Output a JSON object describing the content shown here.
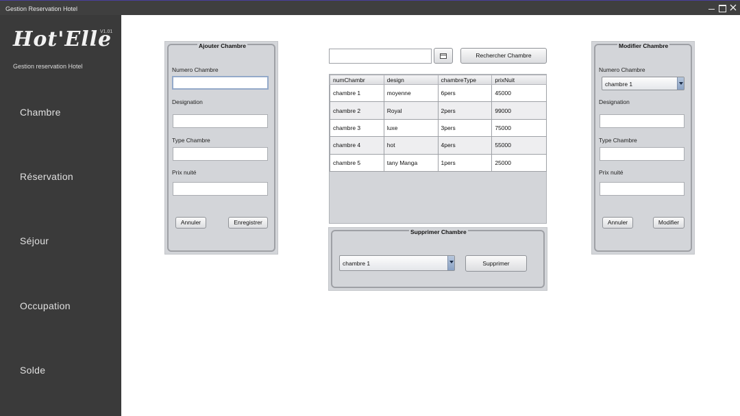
{
  "window": {
    "title": "Gestion Reservation Hotel"
  },
  "sidebar": {
    "logo": "Hot'Elle",
    "version": "V1.01",
    "subtitle": "Gestion reservation Hotel",
    "items": [
      {
        "label": "Chambre"
      },
      {
        "label": "Réservation"
      },
      {
        "label": "Séjour"
      },
      {
        "label": "Occupation"
      },
      {
        "label": "Solde"
      }
    ]
  },
  "add_panel": {
    "title": "Ajouter Chambre",
    "numero_label": "Numero Chambre",
    "numero_value": "",
    "designation_label": "Designation",
    "designation_value": "",
    "type_label": "Type Chambre",
    "type_value": "",
    "prix_label": "Prix nuité",
    "prix_value": "",
    "cancel_label": "Annuler",
    "save_label": "Enregistrer"
  },
  "search": {
    "value": "",
    "button_label": "Rechercher Chambre"
  },
  "table": {
    "columns": [
      "numChambr",
      "design",
      "chambreType",
      "prixNuit"
    ],
    "rows": [
      [
        "chambre 1",
        "moyenne",
        "6pers",
        "45000"
      ],
      [
        "chambre 2",
        "Royal",
        "2pers",
        "99000"
      ],
      [
        "chambre 3",
        "luxe",
        "3pers",
        "75000"
      ],
      [
        "chambre 4",
        "hot",
        "4pers",
        "55000"
      ],
      [
        "chambre 5",
        "tany Manga",
        "1pers",
        "25000"
      ]
    ]
  },
  "delete_panel": {
    "title": "Supprimer Chambre",
    "selected": "chambre 1",
    "delete_label": "Supprimer"
  },
  "edit_panel": {
    "title": "Modifier Chambre",
    "numero_label": "Numero Chambre",
    "selected": "chambre 1",
    "designation_label": "Designation",
    "designation_value": "",
    "type_label": "Type Chambre",
    "type_value": "",
    "prix_label": "Prix nuité",
    "prix_value": "",
    "cancel_label": "Annuler",
    "modify_label": "Modifier"
  },
  "colors": {
    "sidebar": "#3a3a3a",
    "panel": "#d3d5d9",
    "main": "#ffffff",
    "combo_arrow": "#8aa2c4"
  }
}
